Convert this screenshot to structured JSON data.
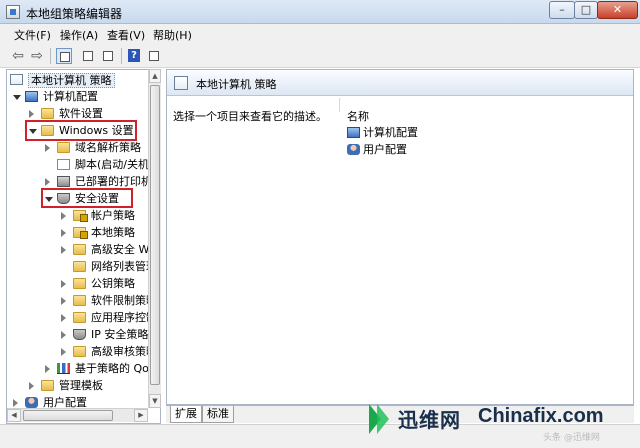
{
  "window": {
    "title": "本地组策略编辑器",
    "controls": {
      "minimize": "–",
      "maximize": "□",
      "close": "✕"
    }
  },
  "menu": [
    "文件(F)",
    "操作(A)",
    "查看(V)",
    "帮助(H)"
  ],
  "toolbar": {
    "back": "⇦",
    "forward": "⇨",
    "help": "?"
  },
  "tree": {
    "root": "本地计算机 策略",
    "items": [
      {
        "label": "计算机配置",
        "icon": "computer-icon",
        "state": "expanded"
      },
      {
        "label": "软件设置",
        "icon": "folder-icon",
        "state": "collapsed"
      },
      {
        "label": "Windows 设置",
        "icon": "folder-icon",
        "state": "expanded"
      },
      {
        "label": "域名解析策略",
        "icon": "folder-icon",
        "state": "collapsed"
      },
      {
        "label": "脚本(启动/关机)",
        "icon": "document-icon",
        "state": "none"
      },
      {
        "label": "已部署的打印机",
        "icon": "printer-icon",
        "state": "collapsed"
      },
      {
        "label": "安全设置",
        "icon": "shield-icon",
        "state": "expanded"
      },
      {
        "label": "帐户策略",
        "icon": "folder-lock-icon",
        "state": "collapsed"
      },
      {
        "label": "本地策略",
        "icon": "folder-lock-icon",
        "state": "collapsed"
      },
      {
        "label": "高级安全 Wi",
        "icon": "folder-icon",
        "state": "collapsed"
      },
      {
        "label": "网络列表管理",
        "icon": "folder-icon",
        "state": "none"
      },
      {
        "label": "公钥策略",
        "icon": "folder-icon",
        "state": "collapsed"
      },
      {
        "label": "软件限制策略",
        "icon": "folder-icon",
        "state": "collapsed"
      },
      {
        "label": "应用程序控制",
        "icon": "folder-icon",
        "state": "collapsed"
      },
      {
        "label": "IP 安全策略",
        "icon": "shield-icon",
        "state": "collapsed"
      },
      {
        "label": "高级审核策略",
        "icon": "folder-icon",
        "state": "collapsed"
      },
      {
        "label": "基于策略的 QoS",
        "icon": "chart-icon",
        "state": "collapsed"
      },
      {
        "label": "管理模板",
        "icon": "folder-icon",
        "state": "collapsed"
      },
      {
        "label": "用户配置",
        "icon": "user-icon",
        "state": "collapsed"
      }
    ]
  },
  "details": {
    "header": "本地计算机 策略",
    "description": "选择一个项目来查看它的描述。",
    "column": "名称",
    "rows": [
      {
        "label": "计算机配置",
        "icon": "computer-icon"
      },
      {
        "label": "用户配置",
        "icon": "user-icon"
      }
    ]
  },
  "tabs": [
    "扩展",
    "标准"
  ],
  "watermark": {
    "brand": "迅维网",
    "site": "Chinafix.com",
    "small": "头条 @迅维网"
  }
}
